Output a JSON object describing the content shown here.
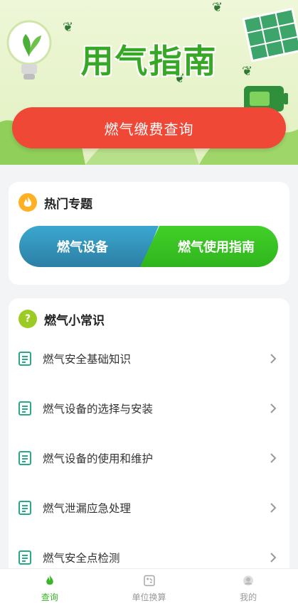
{
  "banner": {
    "title": "用气指南",
    "pay_button": "燃气缴费查询"
  },
  "hot_topics": {
    "title": "热门专题",
    "left_button": "燃气设备",
    "right_button": "燃气使用指南"
  },
  "tips": {
    "title": "燃气小常识",
    "items": [
      {
        "label": "燃气安全基础知识"
      },
      {
        "label": "燃气设备的选择与安装"
      },
      {
        "label": "燃气设备的使用和维护"
      },
      {
        "label": "燃气泄漏应急处理"
      },
      {
        "label": "燃气安全点检测"
      }
    ]
  },
  "tabbar": {
    "tabs": [
      {
        "label": "查询",
        "icon": "flame-icon",
        "active": true
      },
      {
        "label": "单位换算",
        "icon": "calculator-icon",
        "active": false
      },
      {
        "label": "我的",
        "icon": "user-icon",
        "active": false
      }
    ]
  },
  "colors": {
    "accent_green": "#38b528",
    "pay_red": "#ef4836",
    "topic_blue": "#2d7fa5",
    "topic_green": "#2fb51c"
  }
}
